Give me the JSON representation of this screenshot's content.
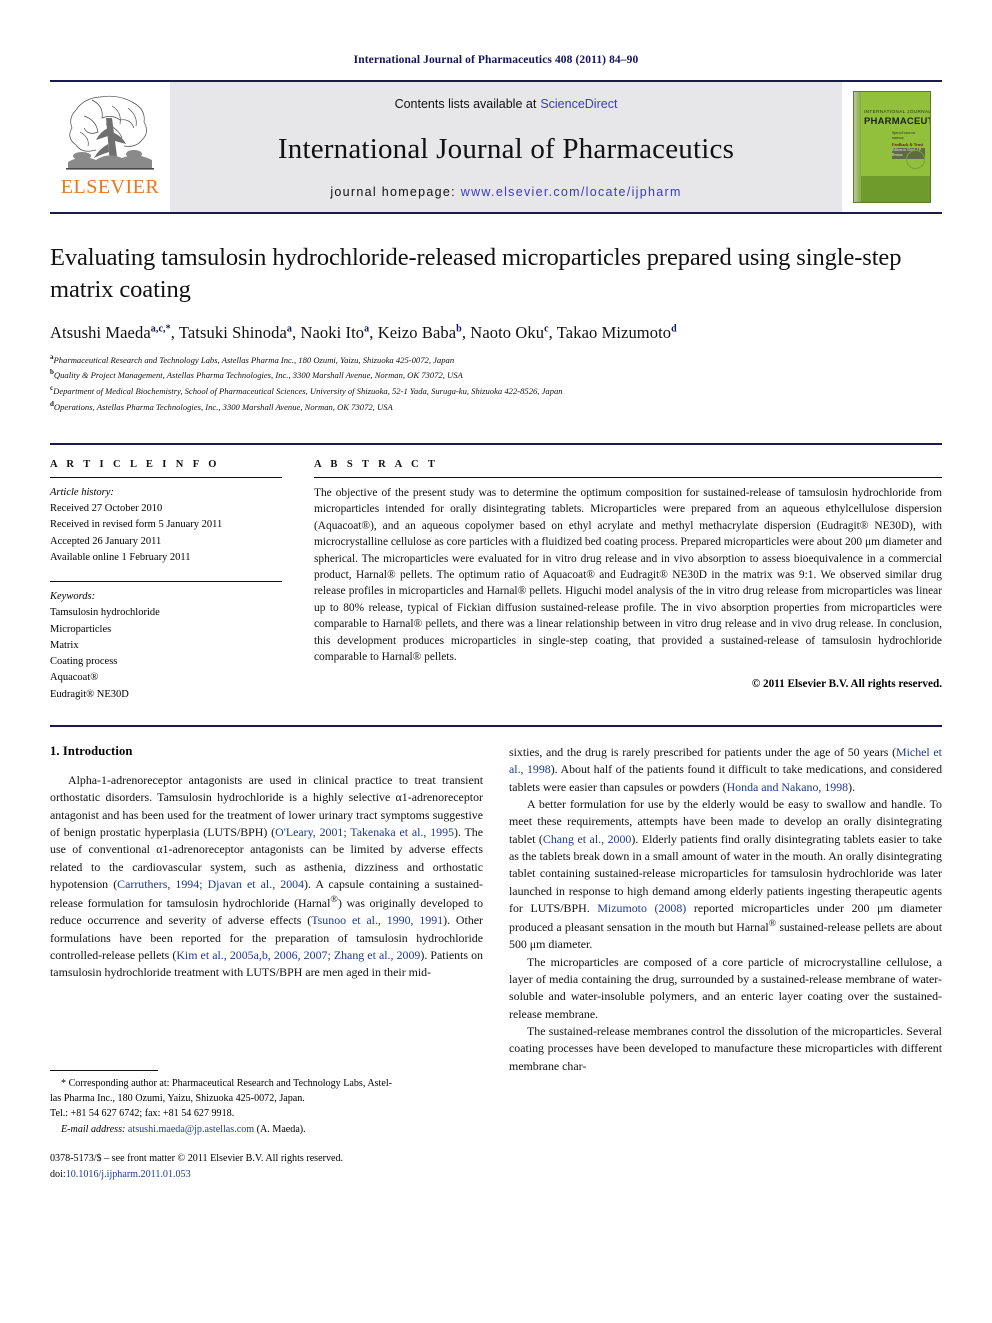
{
  "running_head": "International Journal of Pharmaceutics 408 (2011) 84–90",
  "masthead": {
    "publisher_wordmark": "ELSEVIER",
    "contents_prefix": "Contents lists available at",
    "sciencedirect": "ScienceDirect",
    "journal_name": "International Journal of Pharmaceutics",
    "homepage_prefix": "journal homepage:",
    "homepage_url": "www.elsevier.com/locate/ijpharm",
    "cover": {
      "top_line": "INTERNATIONAL JOURNAL OF",
      "title": "PHARMACEUTICS",
      "sub_a": "Special issue on memory",
      "sub_b": "Feedback & Trust",
      "sub_c": "Editors in Chief: J.P. Remon"
    },
    "accent_blue": "#3b3bbf",
    "banner_bg": "#e7e7e9",
    "rule_color": "#1a1a4e",
    "elsevier_orange": "#e87722",
    "cover_green": "#92bf3c"
  },
  "article": {
    "title": "Evaluating tamsulosin hydrochloride-released microparticles prepared using single-step matrix coating",
    "authors": [
      {
        "name": "Atsushi Maeda",
        "sup": "a,c,*"
      },
      {
        "name": "Tatsuki Shinoda",
        "sup": "a"
      },
      {
        "name": "Naoki Ito",
        "sup": "a"
      },
      {
        "name": "Keizo Baba",
        "sup": "b"
      },
      {
        "name": "Naoto Oku",
        "sup": "c"
      },
      {
        "name": "Takao Mizumoto",
        "sup": "d"
      }
    ],
    "affiliations": [
      {
        "mark": "a",
        "text": "Pharmaceutical Research and Technology Labs, Astellas Pharma Inc., 180 Ozumi, Yaizu, Shizuoka 425-0072, Japan"
      },
      {
        "mark": "b",
        "text": "Quality & Project Management, Astellas Pharma Technologies, Inc., 3300 Marshall Avenue, Norman, OK 73072, USA"
      },
      {
        "mark": "c",
        "text": "Department of Medical Biochemistry, School of Pharmaceutical Sciences, University of Shizuoka, 52-1 Yada, Suruga-ku, Shizuoka 422-8526, Japan"
      },
      {
        "mark": "d",
        "text": "Operations, Astellas Pharma Technologies, Inc., 3300 Marshall Avenue, Norman, OK 73072, USA"
      }
    ]
  },
  "article_info": {
    "heading": "A R T I C L E   I N F O",
    "history_label": "Article history:",
    "history": [
      "Received 27 October 2010",
      "Received in revised form 5 January 2011",
      "Accepted 26 January 2011",
      "Available online 1 February 2011"
    ],
    "keywords_label": "Keywords:",
    "keywords": [
      "Tamsulosin hydrochloride",
      "Microparticles",
      "Matrix",
      "Coating process",
      "Aquacoat®",
      "Eudragit® NE30D"
    ]
  },
  "abstract": {
    "heading": "A B S T R A C T",
    "text": "The objective of the present study was to determine the optimum composition for sustained-release of tamsulosin hydrochloride from microparticles intended for orally disintegrating tablets. Microparticles were prepared from an aqueous ethylcellulose dispersion (Aquacoat®), and an aqueous copolymer based on ethyl acrylate and methyl methacrylate dispersion (Eudragit® NE30D), with microcrystalline cellulose as core particles with a fluidized bed coating process. Prepared microparticles were about 200 μm diameter and spherical. The microparticles were evaluated for in vitro drug release and in vivo absorption to assess bioequivalence in a commercial product, Harnal® pellets. The optimum ratio of Aquacoat® and Eudragit® NE30D in the matrix was 9:1. We observed similar drug release profiles in microparticles and Harnal® pellets. Higuchi model analysis of the in vitro drug release from microparticles was linear up to 80% release, typical of Fickian diffusion sustained-release profile. The in vivo absorption properties from microparticles were comparable to Harnal® pellets, and there was a linear relationship between in vitro drug release and in vivo drug release. In conclusion, this development produces microparticles in single-step coating, that provided a sustained-release of tamsulosin hydrochloride comparable to Harnal® pellets.",
    "copyright": "© 2011 Elsevier B.V. All rights reserved."
  },
  "introduction": {
    "heading": "1.  Introduction",
    "left_paragraph": "Alpha-1-adrenoreceptor antagonists are used in clinical practice to treat transient orthostatic disorders. Tamsulosin hydrochloride is a highly selective α1-adrenoreceptor antagonist and has been used for the treatment of lower urinary tract symptoms suggestive of benign prostatic hyperplasia (LUTS/BPH) (O'Leary, 2001; Takenaka et al., 1995). The use of conventional α1-adrenoreceptor antagonists can be limited by adverse effects related to the cardiovascular system, such as asthenia, dizziness and orthostatic hypotension (Carruthers, 1994; Djavan et al., 2004). A capsule containing a sustained-release formulation for tamsulosin hydrochloride (Harnal®) was originally developed to reduce occurrence and severity of adverse effects (Tsunoo et al., 1990, 1991). Other formulations have been reported for the preparation of tamsulosin hydrochloride controlled-release pellets (Kim et al., 2005a,b, 2006, 2007; Zhang et al., 2009). Patients on tamsulosin hydrochloride treatment with LUTS/BPH are men aged in their mid-",
    "right_paragraph_1": "sixties, and the drug is rarely prescribed for patients under the age of 50 years (Michel et al., 1998). About half of the patients found it difficult to take medications, and considered tablets were easier than capsules or powders (Honda and Nakano, 1998).",
    "right_paragraph_2": "A better formulation for use by the elderly would be easy to swallow and handle. To meet these requirements, attempts have been made to develop an orally disintegrating tablet (Chang et al., 2000). Elderly patients find orally disintegrating tablets easier to take as the tablets break down in a small amount of water in the mouth. An orally disintegrating tablet containing sustained-release microparticles for tamsulosin hydrochloride was later launched in response to high demand among elderly patients ingesting therapeutic agents for LUTS/BPH. Mizumoto (2008) reported microparticles under 200 μm diameter produced a pleasant sensation in the mouth but Harnal® sustained-release pellets are about 500 μm diameter.",
    "right_paragraph_3": "The microparticles are composed of a core particle of microcrystalline cellulose, a layer of media containing the drug, surrounded by a sustained-release membrane of water-soluble and water-insoluble polymers, and an enteric layer coating over the sustained-release membrane.",
    "right_paragraph_4": "The sustained-release membranes control the dissolution of the microparticles. Several coating processes have been developed to manufacture these microparticles with different membrane char-"
  },
  "footnote": {
    "corresponding_line_1": "* Corresponding author at: Pharmaceutical Research and Technology Labs, Astel-",
    "corresponding_line_2": "las Pharma Inc., 180 Ozumi, Yaizu, Shizuoka 425-0072, Japan.",
    "corresponding_line_3": "Tel.: +81 54 627 6742; fax: +81 54 627 9918.",
    "email_label": "E-mail address:",
    "email": "atsushi.maeda@jp.astellas.com",
    "email_suffix": "(A. Maeda).",
    "issn_line": "0378-5173/$ – see front matter © 2011 Elsevier B.V. All rights reserved.",
    "doi_label": "doi:",
    "doi": "10.1016/j.ijpharm.2011.01.053"
  }
}
